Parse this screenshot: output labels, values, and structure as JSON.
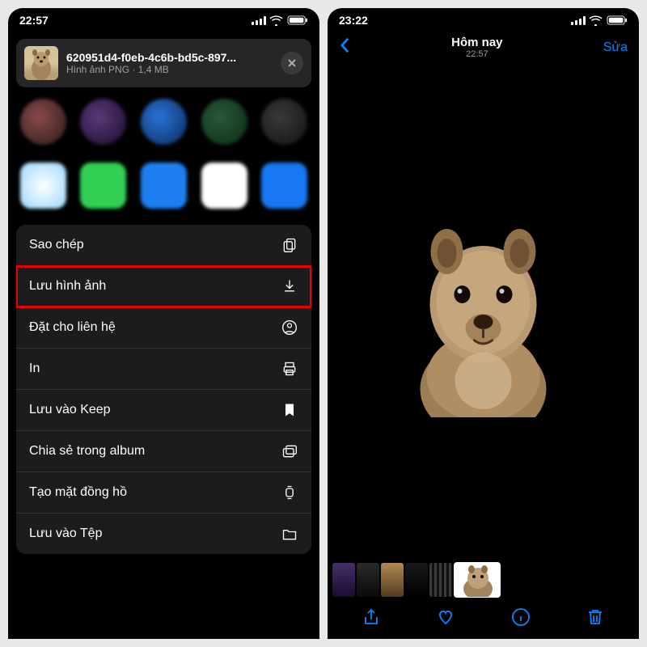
{
  "left": {
    "status_time": "22:57",
    "file_title": "620951d4-f0eb-4c6b-bd5c-897...",
    "file_subtitle": "Hình ảnh PNG · 1,4 MB",
    "actions": [
      {
        "label": "Sao chép",
        "icon": "copy-icon"
      },
      {
        "label": "Lưu hình ảnh",
        "icon": "download-icon",
        "highlighted": true
      },
      {
        "label": "Đặt cho liên hệ",
        "icon": "contact-icon"
      },
      {
        "label": "In",
        "icon": "print-icon"
      },
      {
        "label": "Lưu vào Keep",
        "icon": "bookmark-icon"
      },
      {
        "label": "Chia sẻ trong album",
        "icon": "shared-album-icon"
      },
      {
        "label": "Tạo mặt đồng hồ",
        "icon": "watch-icon"
      },
      {
        "label": "Lưu vào Tệp",
        "icon": "files-icon"
      }
    ]
  },
  "right": {
    "status_time": "23:22",
    "nav_title": "Hôm nay",
    "nav_subtitle": "22:57",
    "edit_label": "Sửa"
  }
}
